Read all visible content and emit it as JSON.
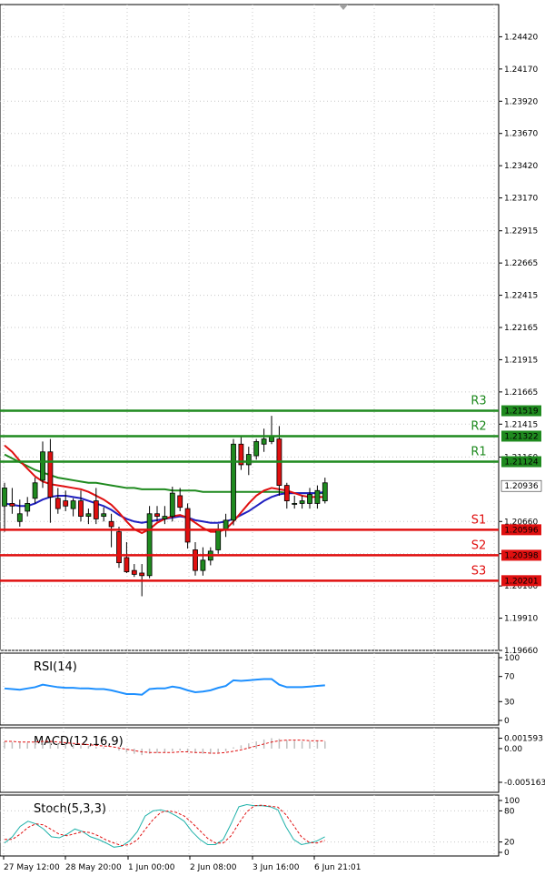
{
  "colors": {
    "bull": "#1f8a1f",
    "bear": "#e01010",
    "ma_red": "#e01010",
    "ma_blue": "#2020c0",
    "ma_green": "#1f8a1f",
    "rsi": "#1e90ff",
    "macd_hist": "#c0c0c0",
    "macd_signal": "#e01010",
    "stoch_main": "#20b2aa",
    "stoch_signal": "#e01010",
    "grid": "#c8c8c8",
    "support": "#e01010",
    "resistance": "#1f8a1f"
  },
  "price_axis": {
    "ticks": [
      "1.24420",
      "1.24170",
      "1.23920",
      "1.23670",
      "1.23420",
      "1.23170",
      "1.22915",
      "1.22665",
      "1.22415",
      "1.22165",
      "1.21915",
      "1.21665",
      "1.21415",
      "1.21160",
      "1.20660",
      "1.20410",
      "1.20160",
      "1.19910",
      "1.19660"
    ],
    "range": [
      1.1966,
      1.2467
    ]
  },
  "time_axis": {
    "labels": [
      "27 May 12:00",
      "28 May 20:00",
      "1 Jun 00:00",
      "2 Jun 08:00",
      "3 Jun 16:00",
      "6 Jun 21:01"
    ]
  },
  "levels": [
    {
      "name": "R3",
      "value": "1.21519",
      "kind": "resistance"
    },
    {
      "name": "R2",
      "value": "1.21322",
      "kind": "resistance"
    },
    {
      "name": "R1",
      "value": "1.21124",
      "kind": "resistance"
    },
    {
      "name": "S1",
      "value": "1.20596",
      "kind": "support"
    },
    {
      "name": "S2",
      "value": "1.20398",
      "kind": "support"
    },
    {
      "name": "S3",
      "value": "1.20201",
      "kind": "support"
    }
  ],
  "current_price": "1.20936",
  "chart_data": {
    "type": "candlestick",
    "candles": [
      {
        "o": 1.2078,
        "h": 1.2096,
        "l": 1.2058,
        "c": 1.2092
      },
      {
        "o": 1.208,
        "h": 1.2092,
        "l": 1.2072,
        "c": 1.2078
      },
      {
        "o": 1.2066,
        "h": 1.2083,
        "l": 1.2062,
        "c": 1.2072
      },
      {
        "o": 1.2074,
        "h": 1.2085,
        "l": 1.207,
        "c": 1.208
      },
      {
        "o": 1.2084,
        "h": 1.21,
        "l": 1.208,
        "c": 1.2096
      },
      {
        "o": 1.2098,
        "h": 1.2128,
        "l": 1.2092,
        "c": 1.212
      },
      {
        "o": 1.212,
        "h": 1.213,
        "l": 1.2065,
        "c": 1.2085
      },
      {
        "o": 1.2084,
        "h": 1.2092,
        "l": 1.2072,
        "c": 1.2076
      },
      {
        "o": 1.2082,
        "h": 1.209,
        "l": 1.2074,
        "c": 1.2078
      },
      {
        "o": 1.2076,
        "h": 1.2084,
        "l": 1.207,
        "c": 1.2082
      },
      {
        "o": 1.2082,
        "h": 1.209,
        "l": 1.2066,
        "c": 1.207
      },
      {
        "o": 1.207,
        "h": 1.2076,
        "l": 1.2064,
        "c": 1.2072
      },
      {
        "o": 1.2082,
        "h": 1.2092,
        "l": 1.2064,
        "c": 1.2068
      },
      {
        "o": 1.207,
        "h": 1.2077,
        "l": 1.2066,
        "c": 1.2072
      },
      {
        "o": 1.2066,
        "h": 1.2072,
        "l": 1.2046,
        "c": 1.2062
      },
      {
        "o": 1.2058,
        "h": 1.2062,
        "l": 1.203,
        "c": 1.2034
      },
      {
        "o": 1.2038,
        "h": 1.205,
        "l": 1.2026,
        "c": 1.2027
      },
      {
        "o": 1.2028,
        "h": 1.2033,
        "l": 1.2023,
        "c": 1.2025
      },
      {
        "o": 1.2026,
        "h": 1.2033,
        "l": 1.2008,
        "c": 1.2024
      },
      {
        "o": 1.2024,
        "h": 1.2078,
        "l": 1.2022,
        "c": 1.2072
      },
      {
        "o": 1.2072,
        "h": 1.2078,
        "l": 1.2066,
        "c": 1.207
      },
      {
        "o": 1.2068,
        "h": 1.2078,
        "l": 1.2064,
        "c": 1.207
      },
      {
        "o": 1.207,
        "h": 1.2093,
        "l": 1.2066,
        "c": 1.2088
      },
      {
        "o": 1.2086,
        "h": 1.2092,
        "l": 1.2074,
        "c": 1.2077
      },
      {
        "o": 1.2076,
        "h": 1.208,
        "l": 1.2045,
        "c": 1.205
      },
      {
        "o": 1.2044,
        "h": 1.205,
        "l": 1.2024,
        "c": 1.2028
      },
      {
        "o": 1.2028,
        "h": 1.2046,
        "l": 1.2024,
        "c": 1.2036
      },
      {
        "o": 1.2036,
        "h": 1.2046,
        "l": 1.2032,
        "c": 1.2043
      },
      {
        "o": 1.2044,
        "h": 1.2064,
        "l": 1.2041,
        "c": 1.206
      },
      {
        "o": 1.206,
        "h": 1.2072,
        "l": 1.2054,
        "c": 1.2067
      },
      {
        "o": 1.2067,
        "h": 1.213,
        "l": 1.2063,
        "c": 1.2126
      },
      {
        "o": 1.2126,
        "h": 1.2132,
        "l": 1.2106,
        "c": 1.211
      },
      {
        "o": 1.211,
        "h": 1.2124,
        "l": 1.2102,
        "c": 1.2118
      },
      {
        "o": 1.2117,
        "h": 1.213,
        "l": 1.2114,
        "c": 1.2128
      },
      {
        "o": 1.2126,
        "h": 1.2138,
        "l": 1.212,
        "c": 1.213
      },
      {
        "o": 1.2128,
        "h": 1.2148,
        "l": 1.2126,
        "c": 1.2132
      },
      {
        "o": 1.213,
        "h": 1.214,
        "l": 1.2086,
        "c": 1.2094
      },
      {
        "o": 1.2094,
        "h": 1.2096,
        "l": 1.2076,
        "c": 1.2082
      },
      {
        "o": 1.208,
        "h": 1.2086,
        "l": 1.2076,
        "c": 1.208
      },
      {
        "o": 1.208,
        "h": 1.2086,
        "l": 1.2076,
        "c": 1.2082
      },
      {
        "o": 1.208,
        "h": 1.2092,
        "l": 1.2076,
        "c": 1.2087
      },
      {
        "o": 1.208,
        "h": 1.2094,
        "l": 1.2076,
        "c": 1.209
      },
      {
        "o": 1.2082,
        "h": 1.21,
        "l": 1.208,
        "c": 1.2096
      }
    ],
    "ma_red": [
      1.2125,
      1.212,
      1.2113,
      1.2107,
      1.2101,
      1.2097,
      1.2095,
      1.2094,
      1.2093,
      1.2092,
      1.2091,
      1.2089,
      1.2086,
      1.2083,
      1.2079,
      1.2073,
      1.2066,
      1.206,
      1.2057,
      1.206,
      1.2065,
      1.2068,
      1.207,
      1.2071,
      1.2069,
      1.2065,
      1.2061,
      1.2058,
      1.2058,
      1.206,
      1.2066,
      1.2073,
      1.208,
      1.2086,
      1.209,
      1.2092,
      1.2091,
      1.209,
      1.2088,
      1.2086,
      1.2085,
      1.2085,
      1.2085
    ],
    "ma_blue": [
      1.208,
      1.2079,
      1.2078,
      1.2078,
      1.208,
      1.2083,
      1.2085,
      1.2086,
      1.2086,
      1.2085,
      1.2084,
      1.2082,
      1.208,
      1.2078,
      1.2075,
      1.2071,
      1.2068,
      1.2066,
      1.2065,
      1.2066,
      1.2067,
      1.2068,
      1.2069,
      1.207,
      1.2069,
      1.2067,
      1.2066,
      1.2065,
      1.2065,
      1.2066,
      1.2068,
      1.2071,
      1.2074,
      1.2078,
      1.2082,
      1.2085,
      1.2087,
      1.2088,
      1.2088,
      1.2088,
      1.2088,
      1.2088,
      1.2089
    ],
    "ma_green": [
      1.2118,
      1.2115,
      1.2112,
      1.2109,
      1.2106,
      1.2104,
      1.2102,
      1.21,
      1.2099,
      1.2098,
      1.2097,
      1.2096,
      1.2096,
      1.2095,
      1.2094,
      1.2093,
      1.2092,
      1.2092,
      1.2091,
      1.2091,
      1.2091,
      1.2091,
      1.209,
      1.209,
      1.209,
      1.209,
      1.2089,
      1.2089,
      1.2089,
      1.2089,
      1.2089,
      1.2089,
      1.2089,
      1.2089,
      1.2089,
      1.2089,
      1.2089,
      1.2088,
      1.2088,
      1.2088,
      1.2088,
      1.2088,
      1.2088
    ],
    "rsi": {
      "title": "RSI(14)",
      "range": [
        0,
        100
      ],
      "ticks": [
        "100",
        "70",
        "30",
        "0"
      ],
      "values": [
        51,
        50,
        49,
        51,
        53,
        57,
        55,
        53,
        52,
        52,
        51,
        51,
        50,
        50,
        48,
        45,
        42,
        42,
        41,
        50,
        51,
        51,
        54,
        52,
        48,
        45,
        46,
        48,
        52,
        55,
        64,
        63,
        64,
        65,
        66,
        66,
        57,
        53,
        53,
        53,
        54,
        55,
        56
      ]
    },
    "macd": {
      "title": "MACD(12,16,9)",
      "range": [
        -0.006,
        0.0025
      ],
      "ticks": [
        "0.001593",
        "0.00",
        "-0.005163"
      ],
      "hist": [
        0.0011,
        0.001,
        0.0009,
        0.0009,
        0.001,
        0.0012,
        0.001,
        0.0008,
        0.0007,
        0.0006,
        0.0005,
        0.0004,
        0.0003,
        0.0002,
        0.0,
        -0.0003,
        -0.0006,
        -0.0008,
        -0.001,
        -0.0008,
        -0.0007,
        -0.0006,
        -0.0004,
        -0.0003,
        -0.0005,
        -0.0007,
        -0.0008,
        -0.0008,
        -0.0006,
        -0.0004,
        0.0002,
        0.0005,
        0.0008,
        0.0011,
        0.0014,
        0.0016,
        0.0015,
        0.0013,
        0.0012,
        0.0011,
        0.0011,
        0.0011,
        0.0011
      ],
      "signal": [
        0.0011,
        0.0011,
        0.001,
        0.001,
        0.001,
        0.0011,
        0.0011,
        0.001,
        0.0009,
        0.0008,
        0.0007,
        0.0006,
        0.0005,
        0.0004,
        0.0003,
        0.0001,
        -0.0001,
        -0.0003,
        -0.0005,
        -0.0006,
        -0.0006,
        -0.0006,
        -0.0006,
        -0.0005,
        -0.0005,
        -0.0006,
        -0.0006,
        -0.0007,
        -0.0007,
        -0.0006,
        -0.0004,
        -0.0002,
        0.0001,
        0.0004,
        0.0007,
        0.001,
        0.0012,
        0.0013,
        0.0013,
        0.0013,
        0.0012,
        0.0012,
        0.0012
      ]
    },
    "stoch": {
      "title": "Stoch(5,3,3)",
      "range": [
        0,
        100
      ],
      "ticks": [
        "100",
        "80",
        "20",
        "0"
      ],
      "main": [
        18,
        30,
        50,
        60,
        55,
        45,
        30,
        28,
        35,
        45,
        40,
        30,
        25,
        18,
        10,
        12,
        22,
        40,
        70,
        80,
        82,
        78,
        70,
        60,
        40,
        25,
        15,
        15,
        25,
        55,
        88,
        92,
        90,
        90,
        88,
        82,
        50,
        25,
        15,
        18,
        22,
        30
      ],
      "signal": [
        25,
        25,
        35,
        48,
        55,
        53,
        44,
        35,
        32,
        36,
        40,
        38,
        32,
        24,
        18,
        13,
        15,
        24,
        44,
        63,
        77,
        80,
        77,
        70,
        57,
        42,
        27,
        18,
        18,
        32,
        56,
        78,
        90,
        91,
        89,
        87,
        73,
        52,
        30,
        19,
        18,
        23
      ]
    }
  }
}
